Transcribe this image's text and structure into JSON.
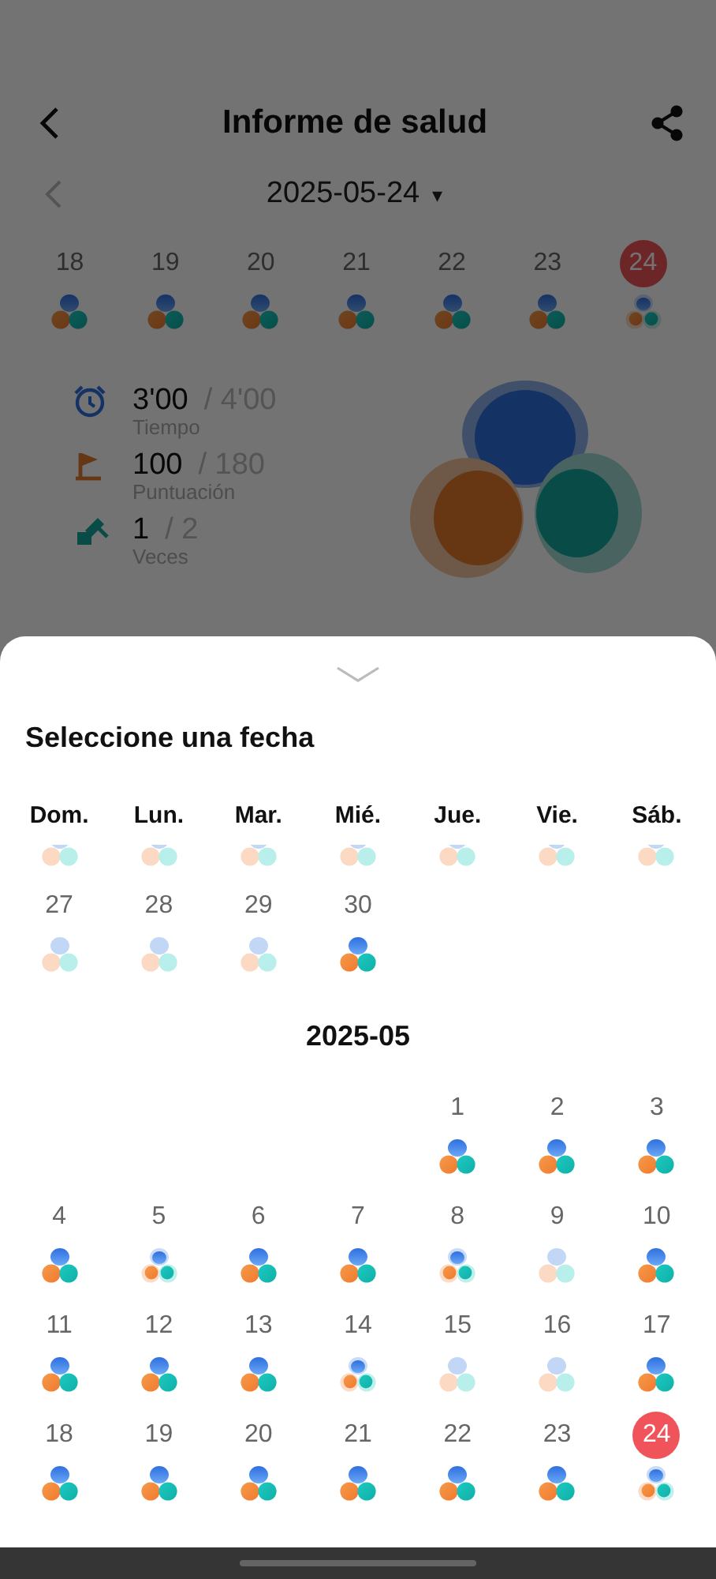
{
  "header": {
    "title": "Informe de salud"
  },
  "date_bar": {
    "date": "2025-05-24",
    "dropdown": "▾"
  },
  "week_strip": [
    {
      "day": "18",
      "kind": "full",
      "selected": false
    },
    {
      "day": "19",
      "kind": "full",
      "selected": false
    },
    {
      "day": "20",
      "kind": "full",
      "selected": false
    },
    {
      "day": "21",
      "kind": "full",
      "selected": false
    },
    {
      "day": "22",
      "kind": "full",
      "selected": false
    },
    {
      "day": "23",
      "kind": "full",
      "selected": false
    },
    {
      "day": "24",
      "kind": "partial",
      "selected": true
    }
  ],
  "stats": [
    {
      "kind": "time",
      "value": "3'00",
      "total": "/ 4'00",
      "label": "Tiempo"
    },
    {
      "kind": "score",
      "value": "100",
      "total": "/ 180",
      "label": "Puntuación"
    },
    {
      "kind": "count",
      "value": "1",
      "total": "/ 2",
      "label": "Veces"
    }
  ],
  "sheet": {
    "title": "Seleccione una fecha",
    "weekdays": [
      "Dom.",
      "Lun.",
      "Mar.",
      "Mié.",
      "Jue.",
      "Vie.",
      "Sáb."
    ],
    "cut_row": [
      {
        "kind": "faint"
      },
      {
        "kind": "faint"
      },
      {
        "kind": "faint"
      },
      {
        "kind": "faint"
      },
      {
        "kind": "faint"
      },
      {
        "kind": "faint"
      },
      {
        "kind": "faint"
      }
    ],
    "prev_month_days": [
      {
        "day": "27",
        "kind": "faint",
        "selected": false
      },
      {
        "day": "28",
        "kind": "faint",
        "selected": false
      },
      {
        "day": "29",
        "kind": "faint",
        "selected": false
      },
      {
        "day": "30",
        "kind": "full",
        "selected": false
      }
    ],
    "month": {
      "title": "2025-05",
      "days": [
        {
          "day": "1",
          "kind": "full",
          "selected": false
        },
        {
          "day": "2",
          "kind": "full",
          "selected": false
        },
        {
          "day": "3",
          "kind": "full",
          "selected": false
        },
        {
          "day": "4",
          "kind": "full",
          "selected": false
        },
        {
          "day": "5",
          "kind": "partial",
          "selected": false
        },
        {
          "day": "6",
          "kind": "full",
          "selected": false
        },
        {
          "day": "7",
          "kind": "full",
          "selected": false
        },
        {
          "day": "8",
          "kind": "partial",
          "selected": false
        },
        {
          "day": "9",
          "kind": "faint",
          "selected": false
        },
        {
          "day": "10",
          "kind": "full",
          "selected": false
        },
        {
          "day": "11",
          "kind": "full",
          "selected": false
        },
        {
          "day": "12",
          "kind": "full",
          "selected": false
        },
        {
          "day": "13",
          "kind": "full",
          "selected": false
        },
        {
          "day": "14",
          "kind": "partial",
          "selected": false
        },
        {
          "day": "15",
          "kind": "faint",
          "selected": false
        },
        {
          "day": "16",
          "kind": "faint",
          "selected": false
        },
        {
          "day": "17",
          "kind": "full",
          "selected": false
        },
        {
          "day": "18",
          "kind": "full",
          "selected": false
        },
        {
          "day": "19",
          "kind": "full",
          "selected": false
        },
        {
          "day": "20",
          "kind": "full",
          "selected": false
        },
        {
          "day": "21",
          "kind": "full",
          "selected": false
        },
        {
          "day": "22",
          "kind": "full",
          "selected": false
        },
        {
          "day": "23",
          "kind": "full",
          "selected": false
        },
        {
          "day": "24",
          "kind": "partial",
          "selected": true
        }
      ]
    }
  }
}
